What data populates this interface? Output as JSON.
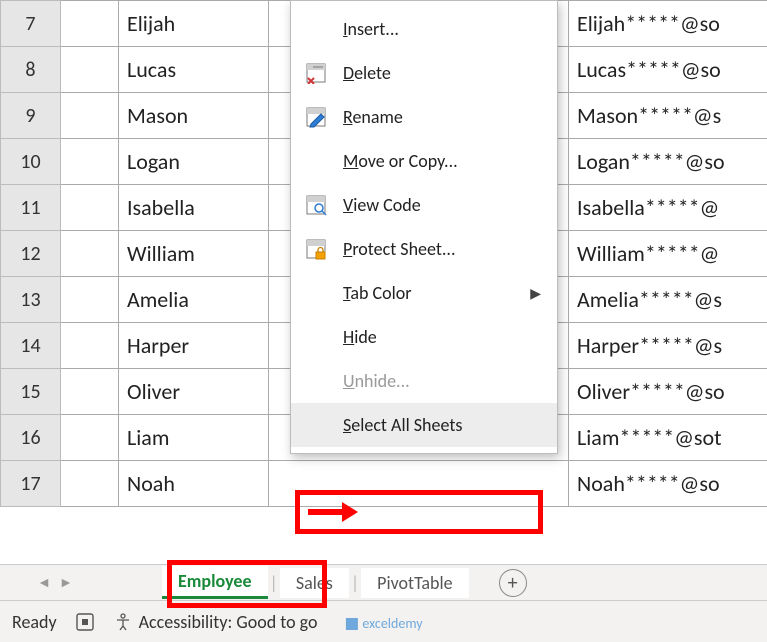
{
  "rows": [
    {
      "num": "7",
      "name": "Elijah",
      "email": "Elijah*****@so"
    },
    {
      "num": "8",
      "name": "Lucas",
      "email": "Lucas*****@so"
    },
    {
      "num": "9",
      "name": "Mason",
      "email": "Mason*****@s"
    },
    {
      "num": "10",
      "name": "Logan",
      "email": "Logan*****@so"
    },
    {
      "num": "11",
      "name": "Isabella",
      "email": "Isabella*****@"
    },
    {
      "num": "12",
      "name": "William",
      "email": "William*****@"
    },
    {
      "num": "13",
      "name": "Amelia",
      "email": "Amelia*****@s"
    },
    {
      "num": "14",
      "name": "Harper",
      "email": "Harper*****@s"
    },
    {
      "num": "15",
      "name": "Oliver",
      "email": "Oliver*****@so"
    },
    {
      "num": "16",
      "name": "Liam",
      "email": "Liam*****@sot"
    },
    {
      "num": "17",
      "name": "Noah",
      "email": "Noah*****@so"
    }
  ],
  "tabs": {
    "active": "Employee",
    "t2": "Sales",
    "t3": "PivotTable"
  },
  "status": {
    "ready": "Ready",
    "accessibility": "Accessibility: Good to go"
  },
  "menu": {
    "insert": "Insert...",
    "delete": "Delete",
    "rename": "Rename",
    "move": "Move or Copy...",
    "viewcode": "View Code",
    "protect": "Protect Sheet...",
    "tabcolor": "Tab Color",
    "hide": "Hide",
    "unhide": "Unhide...",
    "selectall": "Select All Sheets"
  },
  "watermark": "exceldemy"
}
